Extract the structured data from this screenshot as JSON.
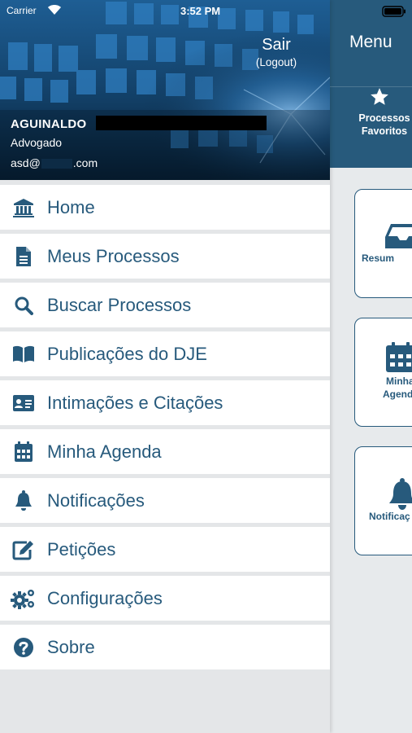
{
  "status_bar": {
    "carrier": "Carrier",
    "time": "3:52 PM"
  },
  "user": {
    "name": "AGUINALDO",
    "role": "Advogado",
    "email_prefix": "asd@",
    "email_suffix": ".com"
  },
  "logout": {
    "label": "Sair",
    "sublabel": "(Logout)"
  },
  "menu_items": [
    {
      "label": "Home",
      "icon": "bank-icon"
    },
    {
      "label": "Meus Processos",
      "icon": "document-icon"
    },
    {
      "label": "Buscar Processos",
      "icon": "search-icon"
    },
    {
      "label": "Publicações do DJE",
      "icon": "book-icon"
    },
    {
      "label": "Intimações e Citações",
      "icon": "id-card-icon"
    },
    {
      "label": "Minha Agenda",
      "icon": "calendar-icon"
    },
    {
      "label": "Notificações",
      "icon": "bell-icon"
    },
    {
      "label": "Petições",
      "icon": "edit-icon"
    },
    {
      "label": "Configurações",
      "icon": "cogs-icon"
    },
    {
      "label": "Sobre",
      "icon": "question-icon"
    }
  ],
  "right_panel": {
    "title": "Menu",
    "favorites": {
      "line1": "Processos",
      "line2": "Favoritos"
    },
    "cards": [
      {
        "line1": "Resum",
        "line2": ""
      },
      {
        "line1": "Minha",
        "line2": "Agend"
      },
      {
        "line1": "Notificaç",
        "line2": ""
      }
    ]
  },
  "colors": {
    "primary": "#275a7c",
    "header_dark": "#0d2b45",
    "background": "#e4e6e8"
  }
}
